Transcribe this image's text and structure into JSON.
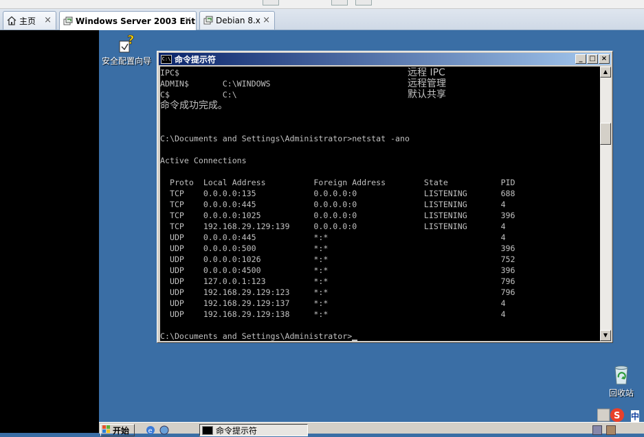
{
  "tabs": [
    {
      "label": "主页",
      "icon": "home-icon"
    },
    {
      "label": "Windows Server 2003 Ent...",
      "icon": "vm-icon",
      "active": true
    },
    {
      "label": "Debian 8.x",
      "icon": "vm-icon"
    }
  ],
  "tab_close_glyph": "×",
  "desktop": {
    "security_wizard_label": "安全配置向导",
    "recycle_bin_label": "回收站"
  },
  "cmd": {
    "title": "命令提示符",
    "icon_text": "C:\\",
    "lines": [
      "IPC$",
      "ADMIN$       C:\\WINDOWS",
      "C$           C:\\",
      "命令成功完成。",
      "",
      "",
      "C:\\Documents and Settings\\Administrator>netstat -ano",
      "",
      "Active Connections",
      "",
      "  Proto  Local Address          Foreign Address        State           PID",
      "  TCP    0.0.0.0:135            0.0.0.0:0              LISTENING       688",
      "  TCP    0.0.0.0:445            0.0.0.0:0              LISTENING       4",
      "  TCP    0.0.0.0:1025           0.0.0.0:0              LISTENING       396",
      "  TCP    192.168.29.129:139     0.0.0.0:0              LISTENING       4",
      "  UDP    0.0.0.0:445            *:*                                    4",
      "  UDP    0.0.0.0:500            *:*                                    396",
      "  UDP    0.0.0.0:1026           *:*                                    752",
      "  UDP    0.0.0.0:4500           *:*                                    396",
      "  UDP    127.0.0.1:123          *:*                                    796",
      "  UDP    192.168.29.129:123     *:*                                    796",
      "  UDP    192.168.29.129:137     *:*                                    4",
      "  UDP    192.168.29.129:138     *:*                                    4",
      "",
      "C:\\Documents and Settings\\Administrator>"
    ],
    "right_notes": [
      "远程 IPC",
      "远程管理",
      "默认共享"
    ]
  },
  "taskbar": {
    "start_label": "开始",
    "task_label": "命令提示符"
  },
  "ime": {
    "label": "中"
  }
}
